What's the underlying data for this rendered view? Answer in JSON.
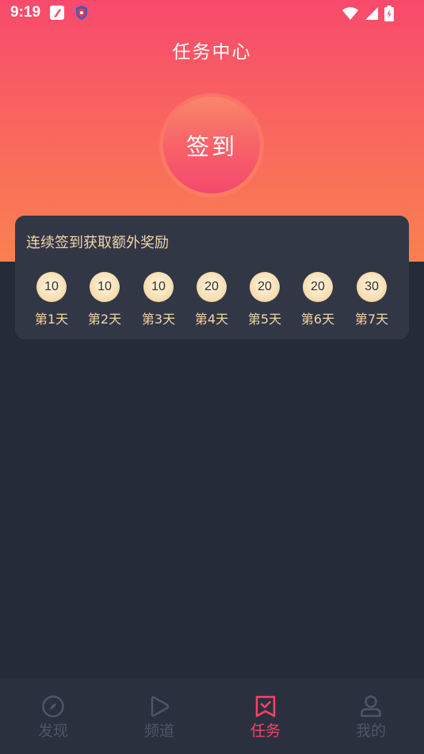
{
  "status_bar": {
    "time": "9:19",
    "left_icons": [
      "edit-square-icon",
      "shield-icon"
    ],
    "right_icons": [
      "wifi-icon",
      "signal-icon",
      "battery-charging-icon"
    ]
  },
  "header": {
    "title": "任务中心"
  },
  "checkin": {
    "button_label": "签到"
  },
  "reward_card": {
    "title": "连续签到获取额外奖励",
    "days": [
      {
        "points": "10",
        "label": "第1天"
      },
      {
        "points": "10",
        "label": "第2天"
      },
      {
        "points": "10",
        "label": "第3天"
      },
      {
        "points": "20",
        "label": "第4天"
      },
      {
        "points": "20",
        "label": "第5天"
      },
      {
        "points": "20",
        "label": "第6天"
      },
      {
        "points": "30",
        "label": "第7天"
      }
    ]
  },
  "tab_bar": {
    "tabs": [
      {
        "label": "发现",
        "icon": "compass-icon",
        "active": false
      },
      {
        "label": "频道",
        "icon": "play-icon",
        "active": false
      },
      {
        "label": "任务",
        "icon": "task-bookmark-icon",
        "active": true
      },
      {
        "label": "我的",
        "icon": "user-icon",
        "active": false
      }
    ]
  },
  "colors": {
    "accent": "#f9426a",
    "gradient_top": "#f84a6c",
    "gradient_bottom": "#f98150",
    "background": "#262b38",
    "card": "#323746",
    "gold_text": "#f1d5a8",
    "inactive_tab": "#4e5566"
  }
}
